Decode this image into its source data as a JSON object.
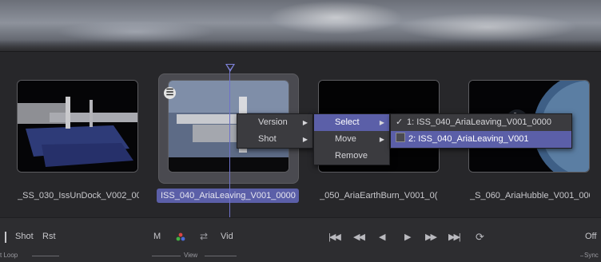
{
  "clips": [
    {
      "label": "_SS_030_IssUnDock_V002_000"
    },
    {
      "label": "ISS_040_AriaLeaving_V001_0000"
    },
    {
      "label": "_050_AriaEarthBurn_V001_0("
    },
    {
      "label": "_S_060_AriaHubble_V001_000"
    }
  ],
  "context_menu": {
    "level1": [
      {
        "label": "Version"
      },
      {
        "label": "Shot"
      }
    ],
    "level2": [
      {
        "label": "Select"
      },
      {
        "label": "Move"
      },
      {
        "label": "Remove"
      }
    ],
    "level3": [
      {
        "check": "✓",
        "label": "1: ISS_040_AriaLeaving_V001_0000"
      },
      {
        "label": "2: ISS_040_AriaLeaving_V001"
      }
    ]
  },
  "toolbar": {
    "loop_group": {
      "label": "t Loop",
      "shot": "Shot",
      "rst": "Rst"
    },
    "view_group": {
      "label": "View",
      "m": "M",
      "vid": "Vid"
    },
    "sync_group": {
      "label": "Sync",
      "off": "Off"
    },
    "transport": {
      "first": "|◀◀",
      "rewind": "◀◀",
      "step_back": "◀",
      "play": "▶",
      "fast_forward": "▶▶",
      "last": "▶▶|",
      "loop": "⟳"
    }
  },
  "colors": {
    "accent": "#5b5fa8",
    "playhead": "#7e82d8"
  },
  "icons": {
    "clip_menu": "hamburger-menu-icon",
    "color_wheel": "color-wheel-icon",
    "swap": "swap-arrows-icon"
  }
}
